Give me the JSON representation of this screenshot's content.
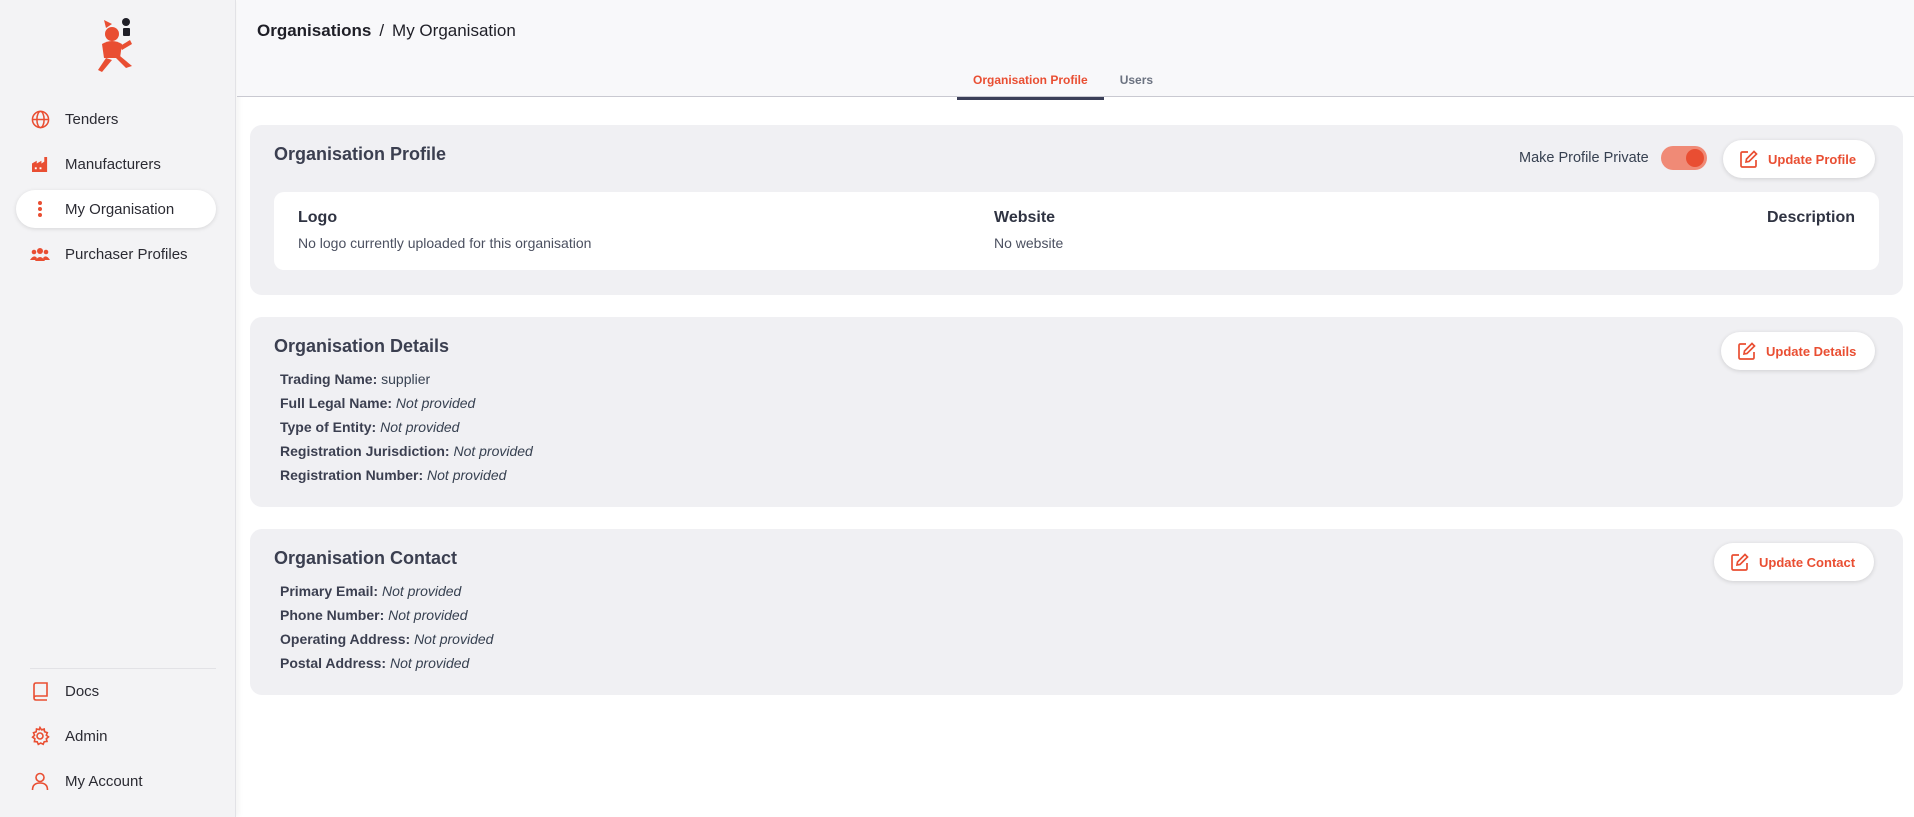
{
  "sidebar": {
    "top_items": [
      {
        "label": "Tenders",
        "icon": "globe-icon"
      },
      {
        "label": "Manufacturers",
        "icon": "factory-icon"
      },
      {
        "label": "My Organisation",
        "icon": "dots-vertical-icon",
        "active": true
      },
      {
        "label": "Purchaser Profiles",
        "icon": "users-group-icon"
      }
    ],
    "bottom_items": [
      {
        "label": "Docs",
        "icon": "book-icon"
      },
      {
        "label": "Admin",
        "icon": "gear-icon"
      },
      {
        "label": "My Account",
        "icon": "user-icon"
      }
    ]
  },
  "header": {
    "breadcrumb_root": "Organisations",
    "breadcrumb_separator": "/",
    "breadcrumb_current": "My Organisation",
    "tabs": [
      {
        "label": "Organisation Profile",
        "active": true
      },
      {
        "label": "Users",
        "active": false
      }
    ]
  },
  "profile": {
    "title": "Organisation Profile",
    "private_label": "Make Profile Private",
    "private_enabled": true,
    "update_label": "Update Profile",
    "logo_heading": "Logo",
    "logo_value": "No logo currently uploaded for this organisation",
    "website_heading": "Website",
    "website_value": "No website",
    "description_heading": "Description"
  },
  "details": {
    "title": "Organisation Details",
    "update_label": "Update Details",
    "fields": [
      {
        "label": "Trading Name:",
        "value": "supplier",
        "provided": true
      },
      {
        "label": "Full Legal Name:",
        "value": "Not provided",
        "provided": false
      },
      {
        "label": "Type of Entity:",
        "value": "Not provided",
        "provided": false
      },
      {
        "label": "Registration Jurisdiction:",
        "value": "Not provided",
        "provided": false
      },
      {
        "label": "Registration Number:",
        "value": "Not provided",
        "provided": false
      }
    ]
  },
  "contact": {
    "title": "Organisation Contact",
    "update_label": "Update Contact",
    "fields": [
      {
        "label": "Primary Email:",
        "value": "Not provided"
      },
      {
        "label": "Phone Number:",
        "value": "Not provided"
      },
      {
        "label": "Operating Address:",
        "value": "Not provided"
      },
      {
        "label": "Postal Address:",
        "value": "Not provided"
      }
    ]
  },
  "colors": {
    "accent": "#e94e32",
    "toggle_track": "#f08a76",
    "tab_underline": "#3b3f58",
    "card_bg": "#f0f0f3"
  }
}
